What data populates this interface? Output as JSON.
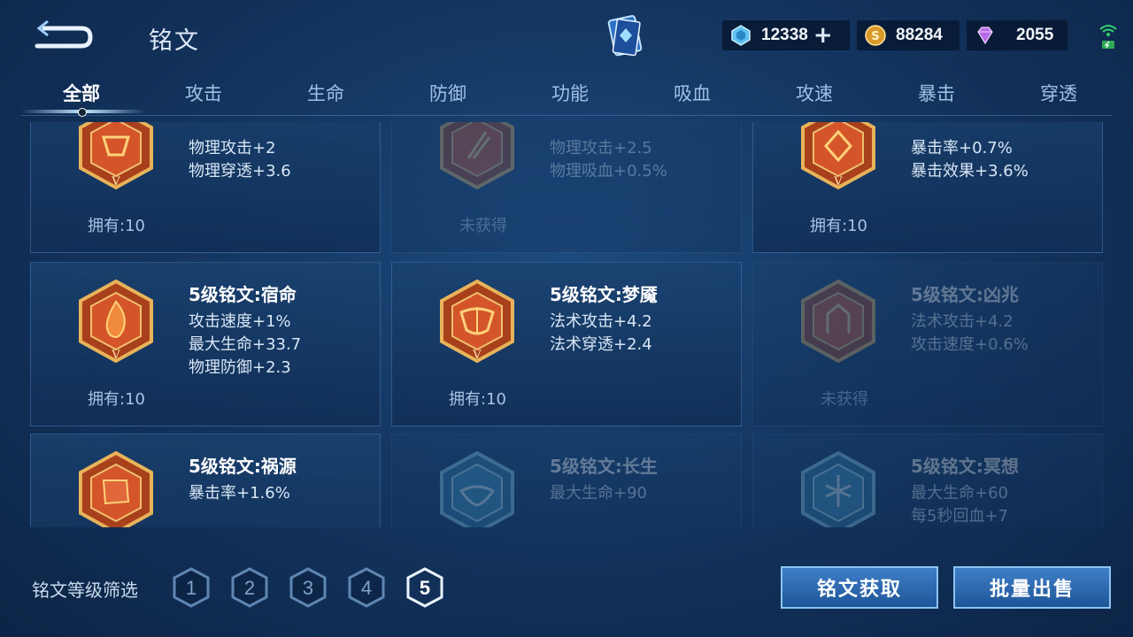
{
  "header": {
    "title": "铭文"
  },
  "currencies": {
    "diamond": "12338",
    "gold": "88284",
    "gem": "2055"
  },
  "tabs": [
    "全部",
    "攻击",
    "生命",
    "防御",
    "功能",
    "吸血",
    "攻速",
    "暴击",
    "穿透"
  ],
  "cards": [
    {
      "name": "",
      "stats": [
        "物理攻击+2",
        "物理穿透+3.6"
      ],
      "owned": "拥有:10",
      "locked": false
    },
    {
      "name": "",
      "stats": [
        "物理攻击+2.5",
        "物理吸血+0.5%"
      ],
      "owned": "未获得",
      "locked": true
    },
    {
      "name": "",
      "stats": [
        "暴击率+0.7%",
        "暴击效果+3.6%"
      ],
      "owned": "拥有:10",
      "locked": false
    },
    {
      "name": "5级铭文:宿命",
      "stats": [
        "攻击速度+1%",
        "最大生命+33.7",
        "物理防御+2.3"
      ],
      "owned": "拥有:10",
      "locked": false
    },
    {
      "name": "5级铭文:梦魇",
      "stats": [
        "法术攻击+4.2",
        "法术穿透+2.4"
      ],
      "owned": "拥有:10",
      "locked": false
    },
    {
      "name": "5级铭文:凶兆",
      "stats": [
        "法术攻击+4.2",
        "攻击速度+0.6%"
      ],
      "owned": "未获得",
      "locked": true
    },
    {
      "name": "5级铭文:祸源",
      "stats": [
        "暴击率+1.6%"
      ],
      "owned": "",
      "locked": false
    },
    {
      "name": "5级铭文:长生",
      "stats": [
        "最大生命+90"
      ],
      "owned": "",
      "locked": true
    },
    {
      "name": "5级铭文:冥想",
      "stats": [
        "最大生命+60",
        "每5秒回血+7"
      ],
      "owned": "",
      "locked": true
    }
  ],
  "filter": {
    "label": "铭文等级筛选",
    "levels": [
      "1",
      "2",
      "3",
      "4",
      "5"
    ],
    "selected": "5"
  },
  "buttons": {
    "obtain": "铭文获取",
    "sell": "批量出售"
  }
}
